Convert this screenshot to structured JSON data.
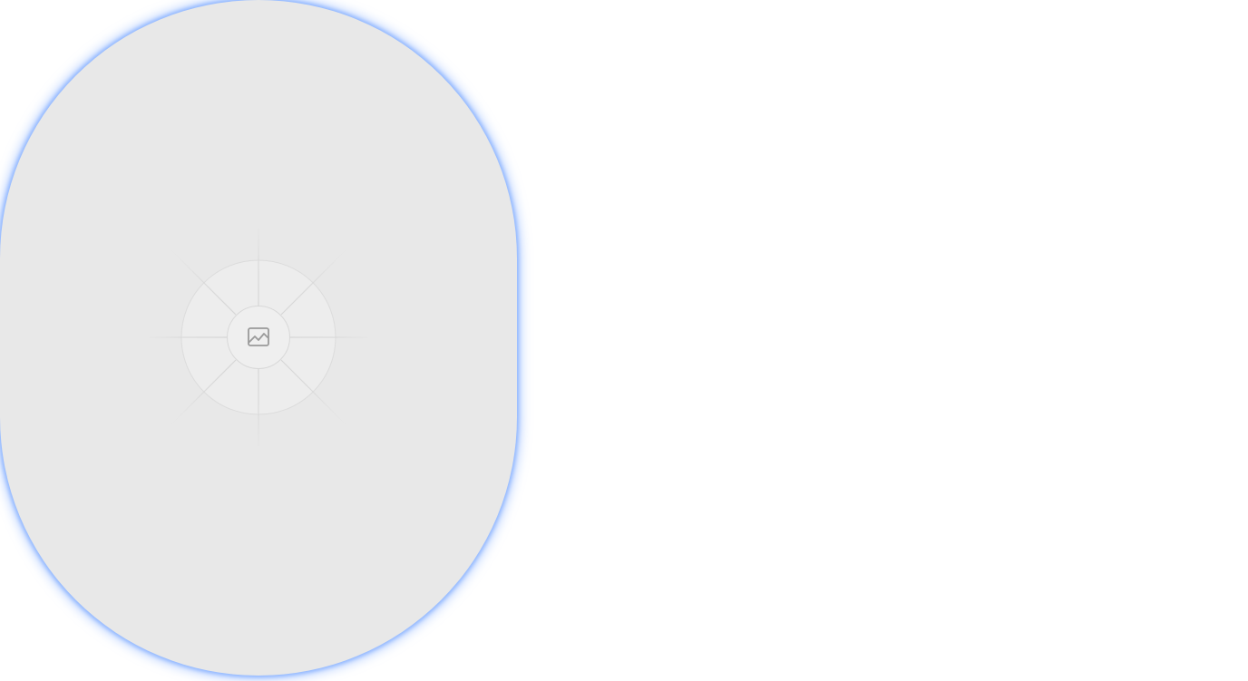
{
  "placeholder": {
    "icon": "image-icon",
    "background_color": "#e8e8e8",
    "glow_color": "#8fb6ff",
    "icon_color": "#9a9a9a"
  }
}
